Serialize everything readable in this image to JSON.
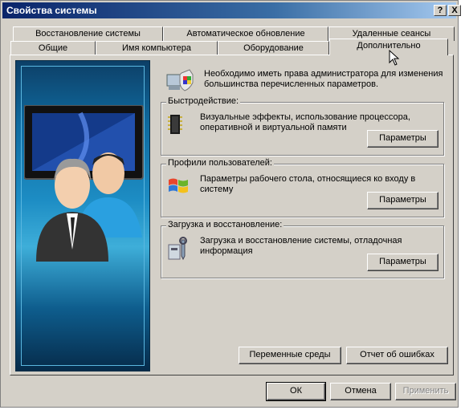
{
  "window": {
    "title": "Свойства системы",
    "help_button": "?",
    "close_button": "X"
  },
  "tabs_row1": [
    {
      "label": "Восстановление системы"
    },
    {
      "label": "Автоматическое обновление"
    },
    {
      "label": "Удаленные сеансы"
    }
  ],
  "tabs_row2": [
    {
      "label": "Общие"
    },
    {
      "label": "Имя компьютера"
    },
    {
      "label": "Оборудование"
    },
    {
      "label": "Дополнительно",
      "active": true
    }
  ],
  "intro": {
    "text": "Необходимо иметь права администратора для изменения большинства перечисленных параметров.",
    "icon": "admin-shield-icon"
  },
  "performance": {
    "label": "Быстродействие:",
    "description": "Визуальные эффекты, использование процессора, оперативной и виртуальной памяти",
    "button": "Параметры",
    "icon": "memory-chip-icon"
  },
  "user_profiles": {
    "label": "Профили пользователей:",
    "description": "Параметры рабочего стола, относящиеся ко входу в систему",
    "button": "Параметры",
    "icon": "windows-logo-icon"
  },
  "startup_recovery": {
    "label": "Загрузка и восстановление:",
    "description": "Загрузка и восстановление системы, отладочная информация",
    "button": "Параметры",
    "icon": "tools-icon"
  },
  "bottom_panel": {
    "env_vars_button": "Переменные среды",
    "error_report_button": "Отчет об ошибках"
  },
  "dialog_buttons": {
    "ok": "ОК",
    "cancel": "Отмена",
    "apply": "Применить"
  }
}
